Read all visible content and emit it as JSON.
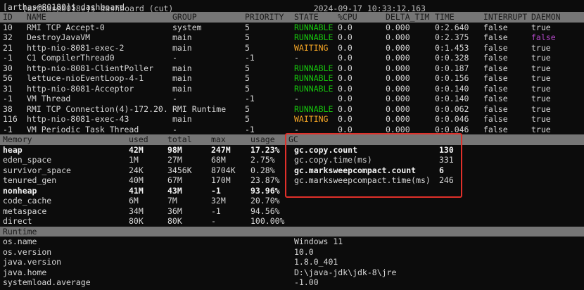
{
  "top_cut": {
    "left": "[arthas@80180]$ dashboard (cut)",
    "right": "2024-09-17 10:33:12.163"
  },
  "prompt": "[arthas@80180]$ dashboard",
  "threads": {
    "headers": [
      "ID",
      "NAME",
      "GROUP",
      "PRIORITY",
      "STATE",
      "%CPU",
      "DELTA_TIM",
      "TIME",
      "INTERRUPT",
      "DAEMON"
    ],
    "rows": [
      {
        "id": "10",
        "name": "RMI TCP Accept-0",
        "group": "system",
        "priority": "5",
        "state": "RUNNABLE",
        "cpu": "0.0",
        "delta": "0.000",
        "time": "0:2.640",
        "interrupt": "false",
        "daemon": "true"
      },
      {
        "id": "32",
        "name": "DestroyJavaVM",
        "group": "main",
        "priority": "5",
        "state": "RUNNABLE",
        "cpu": "0.0",
        "delta": "0.000",
        "time": "0:2.375",
        "interrupt": "false",
        "daemon": "false"
      },
      {
        "id": "21",
        "name": "http-nio-8081-exec-2",
        "group": "main",
        "priority": "5",
        "state": "WAITING",
        "cpu": "0.0",
        "delta": "0.000",
        "time": "0:1.453",
        "interrupt": "false",
        "daemon": "true"
      },
      {
        "id": "-1",
        "name": "C1 CompilerThread0",
        "group": "-",
        "priority": "-1",
        "state": "-",
        "cpu": "0.0",
        "delta": "0.000",
        "time": "0:0.328",
        "interrupt": "false",
        "daemon": "true"
      },
      {
        "id": "30",
        "name": "http-nio-8081-ClientPoller",
        "group": "main",
        "priority": "5",
        "state": "RUNNABLE",
        "cpu": "0.0",
        "delta": "0.000",
        "time": "0:0.187",
        "interrupt": "false",
        "daemon": "true"
      },
      {
        "id": "56",
        "name": "lettuce-nioEventLoop-4-1",
        "group": "main",
        "priority": "5",
        "state": "RUNNABLE",
        "cpu": "0.0",
        "delta": "0.000",
        "time": "0:0.156",
        "interrupt": "false",
        "daemon": "true"
      },
      {
        "id": "31",
        "name": "http-nio-8081-Acceptor",
        "group": "main",
        "priority": "5",
        "state": "RUNNABLE",
        "cpu": "0.0",
        "delta": "0.000",
        "time": "0:0.140",
        "interrupt": "false",
        "daemon": "true"
      },
      {
        "id": "-1",
        "name": "VM Thread",
        "group": "-",
        "priority": "-1",
        "state": "-",
        "cpu": "0.0",
        "delta": "0.000",
        "time": "0:0.140",
        "interrupt": "false",
        "daemon": "true"
      },
      {
        "id": "38",
        "name": "RMI TCP Connection(4)-172.20.",
        "group": "RMI Runtime",
        "priority": "5",
        "state": "RUNNABLE",
        "cpu": "0.0",
        "delta": "0.000",
        "time": "0:0.062",
        "interrupt": "false",
        "daemon": "true"
      },
      {
        "id": "116",
        "name": "http-nio-8081-exec-43",
        "group": "main",
        "priority": "5",
        "state": "WAITING",
        "cpu": "0.0",
        "delta": "0.000",
        "time": "0:0.046",
        "interrupt": "false",
        "daemon": "true"
      },
      {
        "id": "-1",
        "name": "VM Periodic Task Thread",
        "group": "-",
        "priority": "-1",
        "state": "-",
        "cpu": "0.0",
        "delta": "0.000",
        "time": "0:0.046",
        "interrupt": "false",
        "daemon": "true"
      }
    ]
  },
  "memory": {
    "headers": [
      "Memory",
      "used",
      "total",
      "max",
      "usage"
    ],
    "rows": [
      {
        "name": "heap",
        "used": "42M",
        "total": "98M",
        "max": "247M",
        "usage": "17.23%",
        "bold": true
      },
      {
        "name": "eden_space",
        "used": "1M",
        "total": "27M",
        "max": "68M",
        "usage": "2.75%",
        "bold": false
      },
      {
        "name": "survivor_space",
        "used": "24K",
        "total": "3456K",
        "max": "8704K",
        "usage": "0.28%",
        "bold": false
      },
      {
        "name": "tenured_gen",
        "used": "40M",
        "total": "67M",
        "max": "170M",
        "usage": "23.87%",
        "bold": false
      },
      {
        "name": "nonheap",
        "used": "41M",
        "total": "43M",
        "max": "-1",
        "usage": "93.96%",
        "bold": true
      },
      {
        "name": "code_cache",
        "used": "6M",
        "total": "7M",
        "max": "32M",
        "usage": "20.70%",
        "bold": false
      },
      {
        "name": "metaspace",
        "used": "34M",
        "total": "36M",
        "max": "-1",
        "usage": "94.56%",
        "bold": false
      },
      {
        "name": "direct",
        "used": "80K",
        "total": "80K",
        "max": "-",
        "usage": "100.00%",
        "bold": false
      }
    ]
  },
  "gc": {
    "header": "GC",
    "rows": [
      {
        "key": "gc.copy.count",
        "value": "130",
        "bold": true
      },
      {
        "key": "gc.copy.time(ms)",
        "value": "331",
        "bold": false
      },
      {
        "key": "gc.marksweepcompact.count",
        "value": "6",
        "bold": true
      },
      {
        "key": "gc.marksweepcompact.time(ms)",
        "value": "246",
        "bold": false
      }
    ]
  },
  "runtime": {
    "header": "Runtime",
    "rows": [
      {
        "key": "os.name",
        "value": "Windows 11"
      },
      {
        "key": "os.version",
        "value": "10.0"
      },
      {
        "key": "java.version",
        "value": "1.8.0_401"
      },
      {
        "key": "java.home",
        "value": "D:\\java-jdk\\jdk-8\\jre"
      },
      {
        "key": "systemload.average",
        "value": "-1.00"
      }
    ]
  },
  "colors": {
    "runnable": "#16c60c",
    "waiting": "#f9a825",
    "daemon_false": "#b148c6",
    "highlight_box": "#e0302a",
    "header_bg": "#767676"
  }
}
